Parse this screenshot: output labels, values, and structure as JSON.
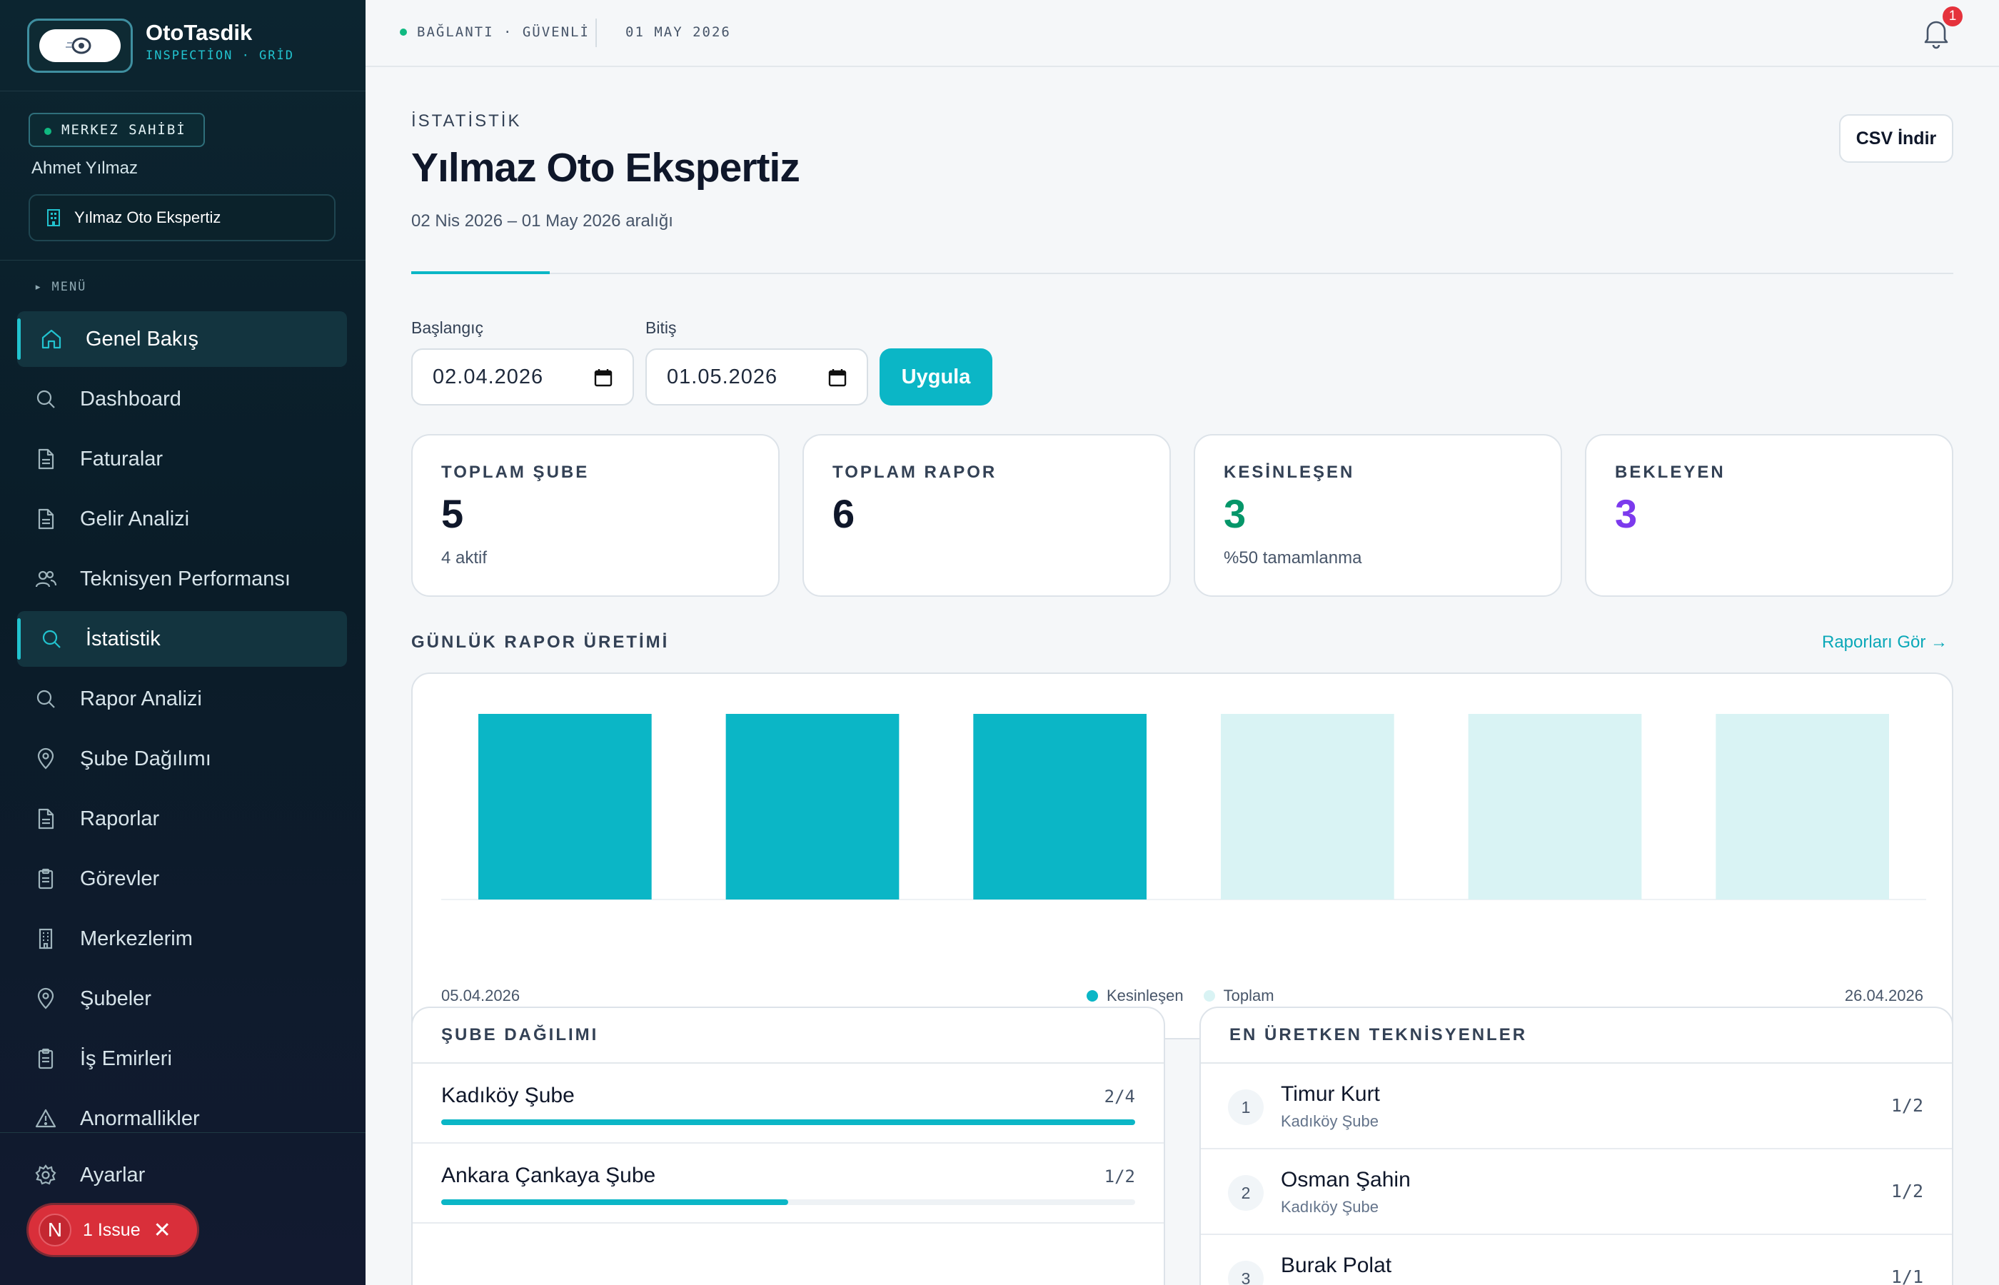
{
  "brand": {
    "name": "OtoTasdik",
    "subtitle": "INSPECTİON · GRİD"
  },
  "user": {
    "role": "MERKEZ SAHİBİ",
    "name": "Ahmet Yılmaz",
    "center": "Yılmaz Oto Ekspertiz"
  },
  "menu": {
    "header": "▸ MENÜ",
    "items": [
      {
        "label": "Genel Bakış",
        "icon": "home-icon",
        "active": true
      },
      {
        "label": "Dashboard",
        "icon": "search-icon",
        "active": false
      },
      {
        "label": "Faturalar",
        "icon": "document-icon",
        "active": false
      },
      {
        "label": "Gelir Analizi",
        "icon": "document-icon",
        "active": false
      },
      {
        "label": "Teknisyen Performansı",
        "icon": "users-icon",
        "active": false
      },
      {
        "label": "İstatistik",
        "icon": "search-icon",
        "active": true
      },
      {
        "label": "Rapor Analizi",
        "icon": "search-icon",
        "active": false
      },
      {
        "label": "Şube Dağılımı",
        "icon": "map-pin-icon",
        "active": false
      },
      {
        "label": "Raporlar",
        "icon": "document-icon",
        "active": false
      },
      {
        "label": "Görevler",
        "icon": "clipboard-icon",
        "active": false
      },
      {
        "label": "Merkezlerim",
        "icon": "building-icon",
        "active": false
      },
      {
        "label": "Şubeler",
        "icon": "map-pin-icon",
        "active": false
      },
      {
        "label": "İş Emirleri",
        "icon": "clipboard-icon",
        "active": false
      },
      {
        "label": "Anormallikler",
        "icon": "warning-icon",
        "active": false
      }
    ],
    "settings": "Ayarlar"
  },
  "issue": {
    "badge": "N",
    "label": "1 Issue"
  },
  "topbar": {
    "connection": "BAĞLANTI · GÜVENLİ",
    "date": "01 MAY 2026",
    "notification_count": "1"
  },
  "page": {
    "eyebrow": "İSTATİSTİK",
    "title": "Yılmaz Oto Ekspertiz",
    "range": "02 Nis 2026 – 01 May 2026 aralığı",
    "csv_button": "CSV İndir"
  },
  "filters": {
    "start_label": "Başlangıç",
    "start_value": "02.04.2026",
    "end_label": "Bitiş",
    "end_value": "01.05.2026",
    "apply": "Uygula"
  },
  "stats": [
    {
      "label": "TOPLAM ŞUBE",
      "value": "5",
      "sub": "4 aktif",
      "color": "#0f172a"
    },
    {
      "label": "TOPLAM RAPOR",
      "value": "6",
      "sub": "",
      "color": "#0f172a"
    },
    {
      "label": "KESİNLEŞEN",
      "value": "3",
      "sub": "%50 tamamlanma",
      "color": "#059669"
    },
    {
      "label": "BEKLEYEN",
      "value": "3",
      "sub": "",
      "color": "#7c3aed"
    }
  ],
  "daily": {
    "title": "GÜNLÜK RAPOR ÜRETİMİ",
    "link": "Raporları Gör →"
  },
  "chart_data": {
    "type": "bar",
    "x_start": "05.04.2026",
    "x_end": "26.04.2026",
    "series": [
      {
        "name": "Kesinleşen",
        "color": "#0bb6c6",
        "values": [
          1,
          1,
          1,
          0,
          0,
          0
        ]
      },
      {
        "name": "Toplam",
        "color": "#d9f3f4",
        "values": [
          1,
          1,
          1,
          1,
          1,
          1
        ]
      }
    ],
    "ylim": [
      0,
      1
    ],
    "grid": false,
    "legend": "bottom-center"
  },
  "branches": {
    "title": "ŞUBE DAĞILIMI",
    "items": [
      {
        "name": "Kadıköy Şube",
        "count": "2/4",
        "progress": 1.0
      },
      {
        "name": "Ankara Çankaya Şube",
        "count": "1/2",
        "progress": 0.5
      }
    ]
  },
  "technicians": {
    "title": "EN ÜRETKEN TEKNİSYENLER",
    "items": [
      {
        "rank": "1",
        "name": "Timur Kurt",
        "branch": "Kadıköy Şube",
        "score": "1/2"
      },
      {
        "rank": "2",
        "name": "Osman Şahin",
        "branch": "Kadıköy Şube",
        "score": "1/2"
      },
      {
        "rank": "3",
        "name": "Burak Polat",
        "branch": "",
        "score": "1/1"
      }
    ]
  }
}
